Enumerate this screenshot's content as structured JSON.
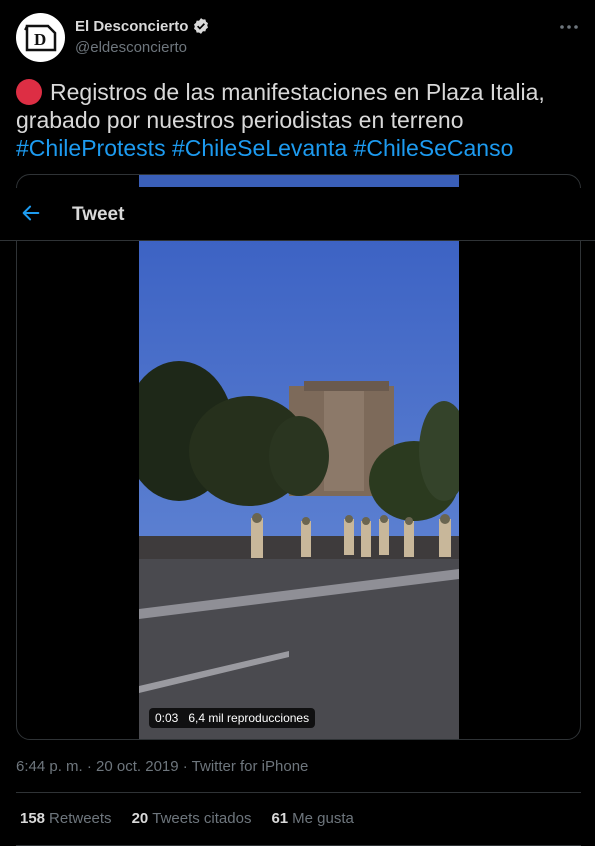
{
  "author": {
    "name": "El Desconcierto",
    "handle": "@eldesconcierto",
    "avatar_letter": "D"
  },
  "tweet": {
    "text_line1": "Registros de las manifestaciones en Plaza Italia,",
    "text_line2": "grabado por nuestros periodistas en terreno",
    "hashtags": [
      "#ChileProtests",
      "#ChileSeLevanta",
      "#ChileSeCanso"
    ]
  },
  "topbar": {
    "title": "Tweet"
  },
  "video": {
    "duration": "0:03",
    "views": "6,4 mil reproducciones"
  },
  "meta": {
    "timestamp": "6:44 p. m. · 20 oct. 2019 · Twitter for iPhone"
  },
  "stats": {
    "retweets_count": "158",
    "retweets_label": "Retweets",
    "quotes_count": "20",
    "quotes_label": "Tweets citados",
    "likes_count": "61",
    "likes_label": "Me gusta"
  },
  "colors": {
    "background": "#000000",
    "link": "#1d9bf0",
    "muted": "#6e767d",
    "red_circle": "#dd2e44"
  }
}
